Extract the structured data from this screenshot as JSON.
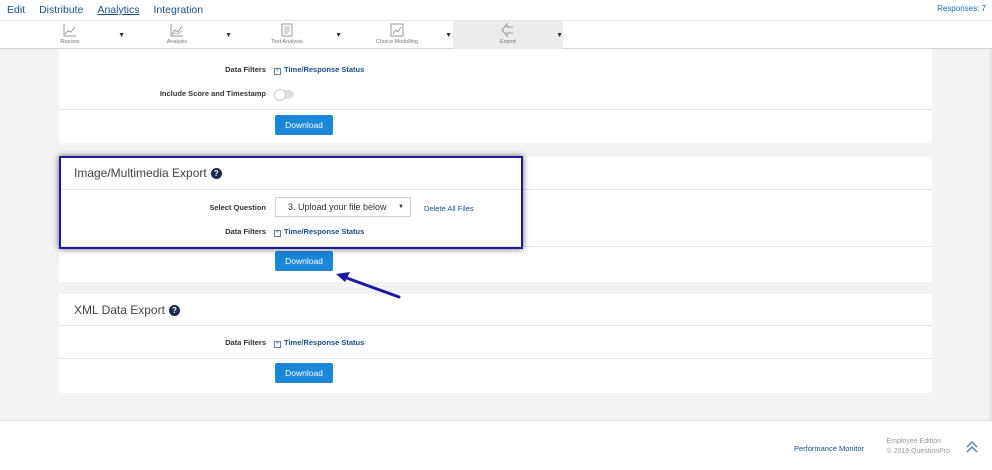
{
  "nav": {
    "tabs": [
      "Edit",
      "Distribute",
      "Analytics",
      "Integration"
    ],
    "active": "Analytics",
    "responses": "Responses: 7"
  },
  "toolbar": {
    "items": [
      {
        "label": "Reports",
        "icon": "line-chart-icon"
      },
      {
        "label": "Analysis",
        "icon": "area-chart-icon"
      },
      {
        "label": "Text Analysis",
        "icon": "document-icon"
      },
      {
        "label": "Choice Modelling",
        "icon": "bar-chart-icon"
      },
      {
        "label": "Export",
        "icon": "share-icon"
      }
    ]
  },
  "top_panel": {
    "data_filters_label": "Data Filters",
    "data_filters_value": "Time/Response Status",
    "include_score_label": "Include Score and Timestamp",
    "download_label": "Download"
  },
  "image_panel": {
    "title": "Image/Multimedia Export",
    "select_question_label": "Select Question",
    "select_question_value": "3. Upload your file below",
    "delete_all_label": "Delete All Files",
    "data_filters_label": "Data Filters",
    "data_filters_value": "Time/Response Status",
    "download_label": "Download"
  },
  "xml_panel": {
    "title": "XML Data Export",
    "data_filters_label": "Data Filters",
    "data_filters_value": "Time/Response Status",
    "download_label": "Download"
  },
  "footer": {
    "performance_monitor": "Performance Monitor",
    "edition": "Employee Edition",
    "copyright": "© 2019 QuestionPro"
  },
  "colors": {
    "accent": "#1a87d9",
    "link": "#1a4f8a",
    "highlight_border": "#1e1aa0"
  }
}
